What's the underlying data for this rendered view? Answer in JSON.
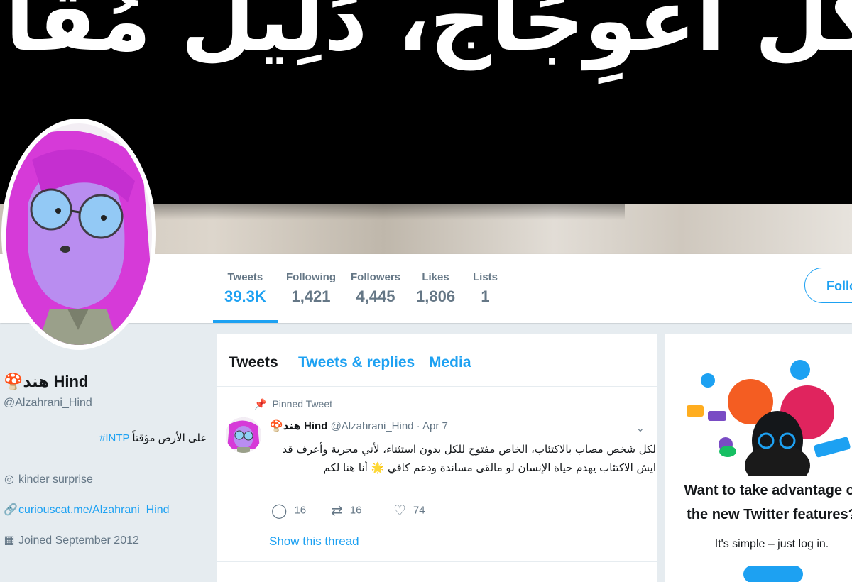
{
  "banner": {
    "text": "كل اعْوِجَاج، دَلِيل مُقَاوَمَة"
  },
  "nav": {
    "stats": [
      {
        "label": "Tweets",
        "value": "39.3K",
        "active": true
      },
      {
        "label": "Following",
        "value": "1,421"
      },
      {
        "label": "Followers",
        "value": "4,445"
      },
      {
        "label": "Likes",
        "value": "1,806"
      },
      {
        "label": "Lists",
        "value": "1"
      }
    ],
    "follow_label": "Follo"
  },
  "profile": {
    "name": "هند Hind",
    "handle": "@Alzahrani_Hind",
    "bio_text": "على الأرض مؤقتاً",
    "bio_tag": "#INTP",
    "location": "kinder surprise",
    "website": "curiouscat.me/Alzahrani_Hind",
    "joined": "Joined September 2012"
  },
  "timeline": {
    "tabs": [
      "Tweets",
      "Tweets & replies",
      "Media"
    ],
    "pinned_label": "Pinned Tweet",
    "tweet": {
      "name": "هند Hind",
      "handle": "@Alzahrani_Hind · Apr 7",
      "text": "لكل شخص مصاب بالاكتئاب، الخاص مفتوح للكل بدون استثناء، لأني مجربة وأعرف قد ايش الاكتئاب يهدم حياة الإنسان لو مالقى مساندة ودعم كافي 🌟 أنا هنا لكم",
      "replies": "16",
      "retweets": "16",
      "likes": "74",
      "show_thread": "Show this thread"
    }
  },
  "promo": {
    "title": "Want to take advantage of the new Twitter features?",
    "subtitle": "It's simple – just log in."
  },
  "colors": {
    "accent": "#1da1f2",
    "muted": "#657786",
    "background": "#e6ecf0"
  },
  "icons": [
    "mushroom-icon",
    "location-icon",
    "link-icon",
    "calendar-icon",
    "pin-icon",
    "reply-icon",
    "retweet-icon",
    "like-icon",
    "chevron-down-icon"
  ]
}
